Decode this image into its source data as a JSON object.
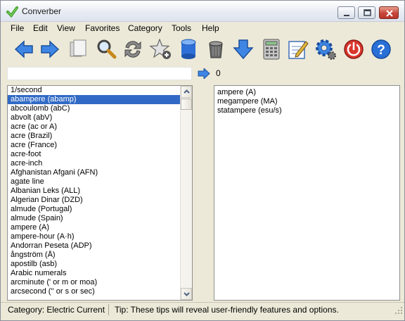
{
  "window": {
    "title": "Converber"
  },
  "menu": [
    "File",
    "Edit",
    "View",
    "Favorites",
    "Category",
    "Tools",
    "Help"
  ],
  "toolbar_icons": [
    "back-arrow-icon",
    "forward-arrow-icon",
    "copy-icon",
    "search-icon",
    "swap-icon",
    "favorite-star-icon",
    "database-icon",
    "trash-icon",
    "download-icon",
    "calculator-icon",
    "notepad-icon",
    "settings-gear-icon",
    "power-icon",
    "help-icon"
  ],
  "conversion": {
    "input_value": "",
    "result_value": "0"
  },
  "source_units": [
    "1/second",
    "abampere (abamp)",
    "abcoulomb (abC)",
    "abvolt (abV)",
    "acre (ac or A)",
    "acre (Brazil)",
    "acre (France)",
    "acre-foot",
    "acre-inch",
    "Afghanistan Afgani (AFN)",
    "agate line",
    "Albanian Leks (ALL)",
    "Algerian Dinar (DZD)",
    "almude (Portugal)",
    "almude (Spain)",
    "ampere (A)",
    "ampere-hour (A·h)",
    "Andorran Peseta (ADP)",
    "ångström (Å)",
    "apostilb (asb)",
    "Arabic numerals",
    "arcminute (' or m or moa)",
    "arcsecond ('' or s or sec)"
  ],
  "selected_source_index": 1,
  "target_units": [
    "ampere (A)",
    "megampere (MA)",
    "statampere (esu/s)"
  ],
  "status": {
    "category": "Category: Electric Current",
    "tip": "Tip: These tips will reveal user-friendly features and options."
  },
  "colors": {
    "selection": "#316ac5",
    "accent_blue": "#2a6fd6"
  }
}
